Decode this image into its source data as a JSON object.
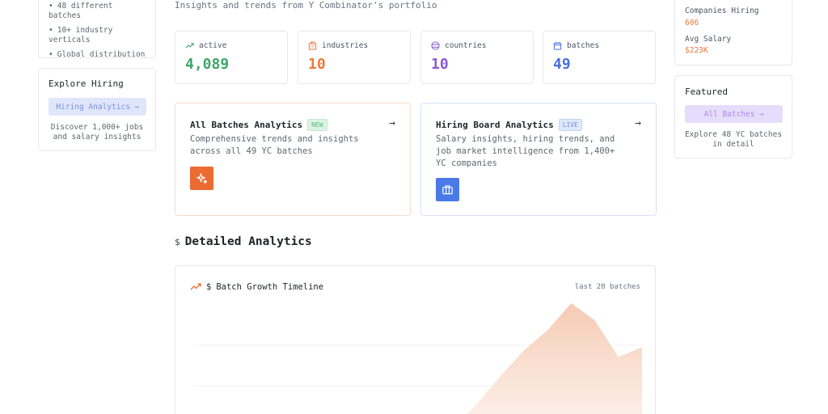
{
  "left_sidebar": {
    "stats_list": [
      "48 different batches",
      "10+ industry verticals",
      "Global distribution"
    ],
    "explore": {
      "title": "Explore Hiring",
      "button_label": "Hiring Analytics",
      "button_arrow": "→",
      "description": "Discover 1,000+ jobs and salary insights"
    }
  },
  "main": {
    "subtitle": "Insights and trends from Y Combinator's portfolio",
    "stats": [
      {
        "label": "active",
        "value": "4,089",
        "color": "#3fa66a",
        "icon": "trending-up-icon"
      },
      {
        "label": "industries",
        "value": "10",
        "color": "#ea7a3a",
        "icon": "building-icon"
      },
      {
        "label": "countries",
        "value": "10",
        "color": "#8a5ad8",
        "icon": "globe-icon"
      },
      {
        "label": "batches",
        "value": "49",
        "color": "#4a6fe0",
        "icon": "calendar-icon"
      }
    ],
    "features": [
      {
        "title": "All Batches Analytics",
        "badge": "NEW",
        "description": "Comprehensive trends and insights across all 49 YC batches",
        "arrow": "→",
        "icon": "sparkles-icon",
        "icon_color": "#ec6b33"
      },
      {
        "title": "Hiring Board Analytics",
        "badge": "LIVE",
        "description": "Salary insights, hiring trends, and job market intelligence from 1,400+ YC companies",
        "arrow": "→",
        "icon": "briefcase-icon",
        "icon_color": "#4a7ae8"
      }
    ],
    "section": {
      "prefix": "$",
      "title": "Detailed Analytics"
    },
    "chart": {
      "prefix": "$",
      "title": "Batch Growth Timeline",
      "meta": "last 20 batches",
      "icon": "trending-up-icon"
    }
  },
  "right_sidebar": {
    "stats": [
      {
        "label": "Companies Hiring",
        "value": "606"
      },
      {
        "label": "Avg Salary",
        "value": "$223K"
      }
    ],
    "featured": {
      "title": "Featured",
      "button_label": "All Batches",
      "button_arrow": "→",
      "description": "Explore 48 YC batches in detail"
    }
  },
  "chart_data": {
    "type": "area",
    "title": "Batch Growth Timeline",
    "series": [
      {
        "values": [
          0,
          0,
          0,
          0,
          0,
          0,
          0,
          0,
          0,
          0,
          0,
          0,
          22,
          48,
          72,
          91,
          116,
          100,
          66,
          75
        ]
      }
    ]
  }
}
